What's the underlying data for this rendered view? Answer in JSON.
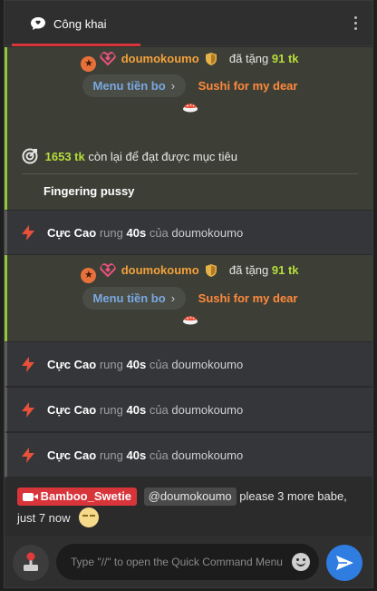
{
  "header": {
    "tab_label": "Công khai",
    "accent": "#d8353b"
  },
  "tips": [
    {
      "username": "doumokoumo",
      "action": "đã tặng",
      "amount": "91 tk",
      "menu_label": "Menu tiền bo",
      "item": "Sushi for my dear",
      "icon": "sushi-icon"
    },
    {
      "username": "doumokoumo",
      "action": "đã tặng",
      "amount": "91 tk",
      "menu_label": "Menu tiền bo",
      "item": "Sushi for my dear",
      "icon": "sushi-icon"
    }
  ],
  "goal": {
    "amount": "1653 tk",
    "text": "còn lại để đạt được mục tiêu",
    "title": "Fingering pussy"
  },
  "vibrations": [
    {
      "level": "Cực Cao",
      "verb": "rung",
      "duration": "40s",
      "of": "của",
      "user": "doumokoumo"
    },
    {
      "level": "Cực Cao",
      "verb": "rung",
      "duration": "40s",
      "of": "của",
      "user": "doumokoumo"
    },
    {
      "level": "Cực Cao",
      "verb": "rung",
      "duration": "40s",
      "of": "của",
      "user": "doumokoumo"
    },
    {
      "level": "Cực Cao",
      "verb": "rung",
      "duration": "40s",
      "of": "của",
      "user": "doumokoumo"
    }
  ],
  "chat": {
    "sender": "Bamboo_Swetie",
    "mention": "@doumokoumo",
    "text": "please 3 more babe, just 7 now"
  },
  "composer": {
    "placeholder": "Type \"//\" to open the Quick Command Menu"
  },
  "colors": {
    "tip_bg": "#3d3f36",
    "tip_accent": "#8fc93a",
    "username": "#f3a13b",
    "amount": "#b5dd3b",
    "item": "#ff8a3d",
    "send": "#2f7de1"
  }
}
